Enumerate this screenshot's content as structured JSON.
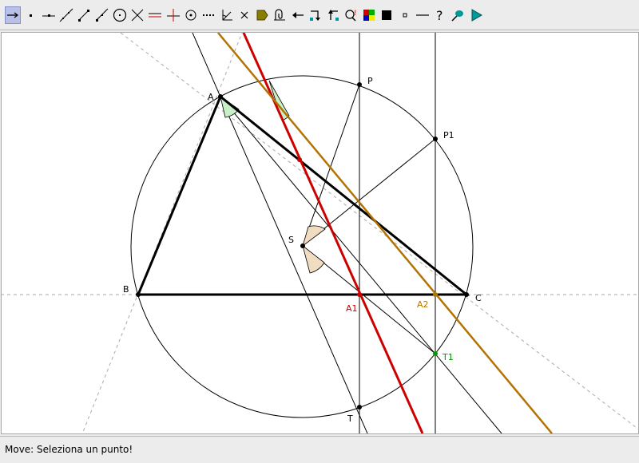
{
  "toolbar": {
    "tools": [
      {
        "name": "move-tool",
        "icon": "arrow-move-icon"
      },
      {
        "name": "point-tool",
        "icon": "point-icon"
      },
      {
        "name": "point-on-line-tool",
        "icon": "point-on-line-icon"
      },
      {
        "name": "line-tool",
        "icon": "line-icon"
      },
      {
        "name": "segment-tool",
        "icon": "segment-icon"
      },
      {
        "name": "ray-tool",
        "icon": "ray-icon"
      },
      {
        "name": "circle-tool",
        "icon": "circle-icon"
      },
      {
        "name": "intersection-tool",
        "icon": "intersection-icon"
      },
      {
        "name": "parallel-tool",
        "icon": "parallel-icon"
      },
      {
        "name": "perpendicular-tool",
        "icon": "perpendicular-icon"
      },
      {
        "name": "midpoint-tool",
        "icon": "midpoint-icon"
      },
      {
        "name": "dotted-line-tool",
        "icon": "dotted-line-icon"
      },
      {
        "name": "angle-tool",
        "icon": "angle-icon"
      },
      {
        "name": "delete-tool",
        "icon": "cross-icon"
      },
      {
        "name": "label-tool",
        "icon": "label-icon"
      },
      {
        "name": "macro-tool",
        "icon": "macro-icon"
      },
      {
        "name": "undo-tool",
        "icon": "undo-arrow-icon"
      },
      {
        "name": "hide-tool",
        "icon": "hide-icon"
      },
      {
        "name": "show-tool",
        "icon": "show-icon"
      },
      {
        "name": "zoom-tool",
        "icon": "zoom-icon"
      },
      {
        "name": "color-tool",
        "icon": "color-grid-icon"
      },
      {
        "name": "fill-tool",
        "icon": "black-square-icon"
      },
      {
        "name": "point-size-tool",
        "icon": "small-square-icon"
      },
      {
        "name": "line-style-tool",
        "icon": "line-style-icon"
      },
      {
        "name": "help-tool",
        "icon": "question-icon"
      },
      {
        "name": "comment-tool",
        "icon": "comment-icon"
      },
      {
        "name": "run-tool",
        "icon": "play-icon"
      }
    ]
  },
  "points": {
    "A": "A",
    "B": "B",
    "C": "C",
    "P": "P",
    "P1": "P1",
    "S": "S",
    "T": "T",
    "A1": "A1",
    "A2": "A2",
    "T1": "T1"
  },
  "colors": {
    "red_line": "#cc0000",
    "orange_line": "#b37300",
    "green_point": "#009900",
    "angle_fill_green": "#c8f0c8",
    "angle_fill_tan": "#f0dcc0"
  },
  "status": {
    "text": "Move: Seleziona un punto!"
  }
}
